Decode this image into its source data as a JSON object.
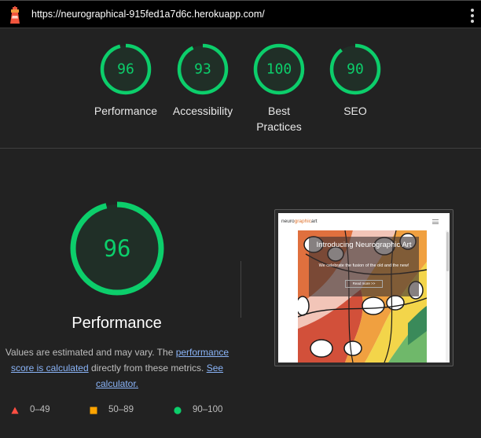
{
  "topbar": {
    "url": "https://neurographical-915fed1a7d6c.herokuapp.com/",
    "logo_icon": "lighthouse-icon",
    "menu_icon": "more-vertical-icon"
  },
  "colors": {
    "pass": "#0cce6b",
    "average": "#ffa400",
    "fail": "#ff4e42",
    "link": "#8ab4f8",
    "background": "#222222"
  },
  "summary_gauges": [
    {
      "score": 96,
      "label": "Performance"
    },
    {
      "score": 93,
      "label": "Accessibility"
    },
    {
      "score": 100,
      "label": "Best Practices"
    },
    {
      "score": 90,
      "label": "SEO"
    }
  ],
  "performance": {
    "score": 96,
    "title": "Performance",
    "desc_before": "Values are estimated and may vary. The ",
    "desc_link": "performance score is calculated",
    "desc_middle": " directly from these metrics. ",
    "calc_link": "See calculator."
  },
  "legend": [
    {
      "range": "0–49",
      "icon": "triangle-icon",
      "color": "#ff4e42"
    },
    {
      "range": "50–89",
      "icon": "square-icon",
      "color": "#ffa400"
    },
    {
      "range": "90–100",
      "icon": "circle-icon",
      "color": "#0cce6b"
    }
  ],
  "screenshot": {
    "brand_part1": "neuro",
    "brand_part2": "graphic",
    "brand_part3": "art",
    "hero_title": "Introducing Neurographic Art",
    "hero_subtitle": "We celebrate the fusion of the old and the new!",
    "hero_button": "Read more >>"
  }
}
